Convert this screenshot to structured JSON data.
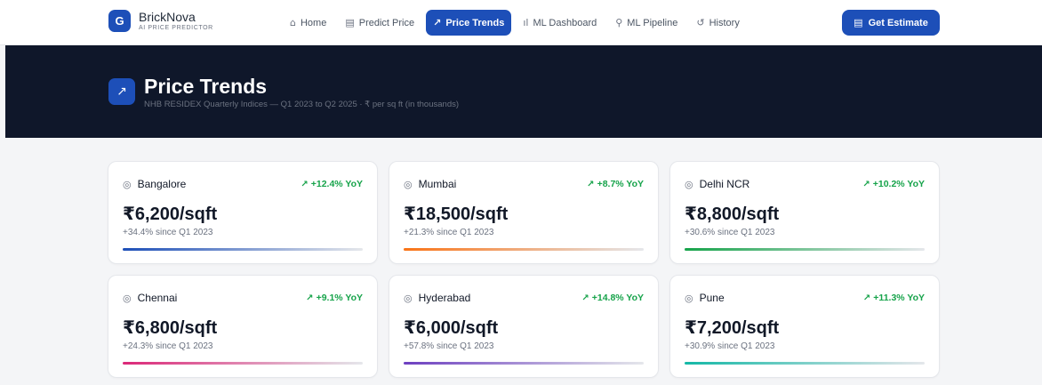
{
  "brand": {
    "logo_letter": "G",
    "name": "BrickNova",
    "tagline": "AI PRICE PREDICTOR"
  },
  "nav": [
    {
      "label": "Home",
      "icon": "home-icon",
      "glyph": "⌂",
      "active": false
    },
    {
      "label": "Predict Price",
      "icon": "calculator-icon",
      "glyph": "▤",
      "active": false
    },
    {
      "label": "Price Trends",
      "icon": "trending-up-icon",
      "glyph": "↗",
      "active": true
    },
    {
      "label": "ML Dashboard",
      "icon": "bar-chart-icon",
      "glyph": "ıl",
      "active": false
    },
    {
      "label": "ML Pipeline",
      "icon": "pipeline-icon",
      "glyph": "⚲",
      "active": false
    },
    {
      "label": "History",
      "icon": "history-icon",
      "glyph": "↺",
      "active": false
    }
  ],
  "cta": {
    "label": "Get Estimate",
    "icon": "calculator-icon",
    "glyph": "▤"
  },
  "hero": {
    "title": "Price Trends",
    "subtitle": "NHB RESIDEX Quarterly Indices — Q1 2023 to Q2 2025 · ₹ per sq ft (in thousands)"
  },
  "cities": [
    {
      "name": "Bangalore",
      "yoy": "+12.4% YoY",
      "price": "₹6,200/sqft",
      "since": "+34.4% since Q1 2023",
      "color_from": "#1d4fb8",
      "color_to": "#e5e7eb"
    },
    {
      "name": "Mumbai",
      "yoy": "+8.7% YoY",
      "price": "₹18,500/sqft",
      "since": "+21.3% since Q1 2023",
      "color_from": "#f97316",
      "color_to": "#e5e7eb"
    },
    {
      "name": "Delhi NCR",
      "yoy": "+10.2% YoY",
      "price": "₹8,800/sqft",
      "since": "+30.6% since Q1 2023",
      "color_from": "#16a34a",
      "color_to": "#e5e7eb"
    },
    {
      "name": "Chennai",
      "yoy": "+9.1% YoY",
      "price": "₹6,800/sqft",
      "since": "+24.3% since Q1 2023",
      "color_from": "#db2777",
      "color_to": "#e5e7eb"
    },
    {
      "name": "Hyderabad",
      "yoy": "+14.8% YoY",
      "price": "₹6,000/sqft",
      "since": "+57.8% since Q1 2023",
      "color_from": "#6d3fc0",
      "color_to": "#e5e7eb"
    },
    {
      "name": "Pune",
      "yoy": "+11.3% YoY",
      "price": "₹7,200/sqft",
      "since": "+30.9% since Q1 2023",
      "color_from": "#14b8a6",
      "color_to": "#e5e7eb"
    }
  ]
}
